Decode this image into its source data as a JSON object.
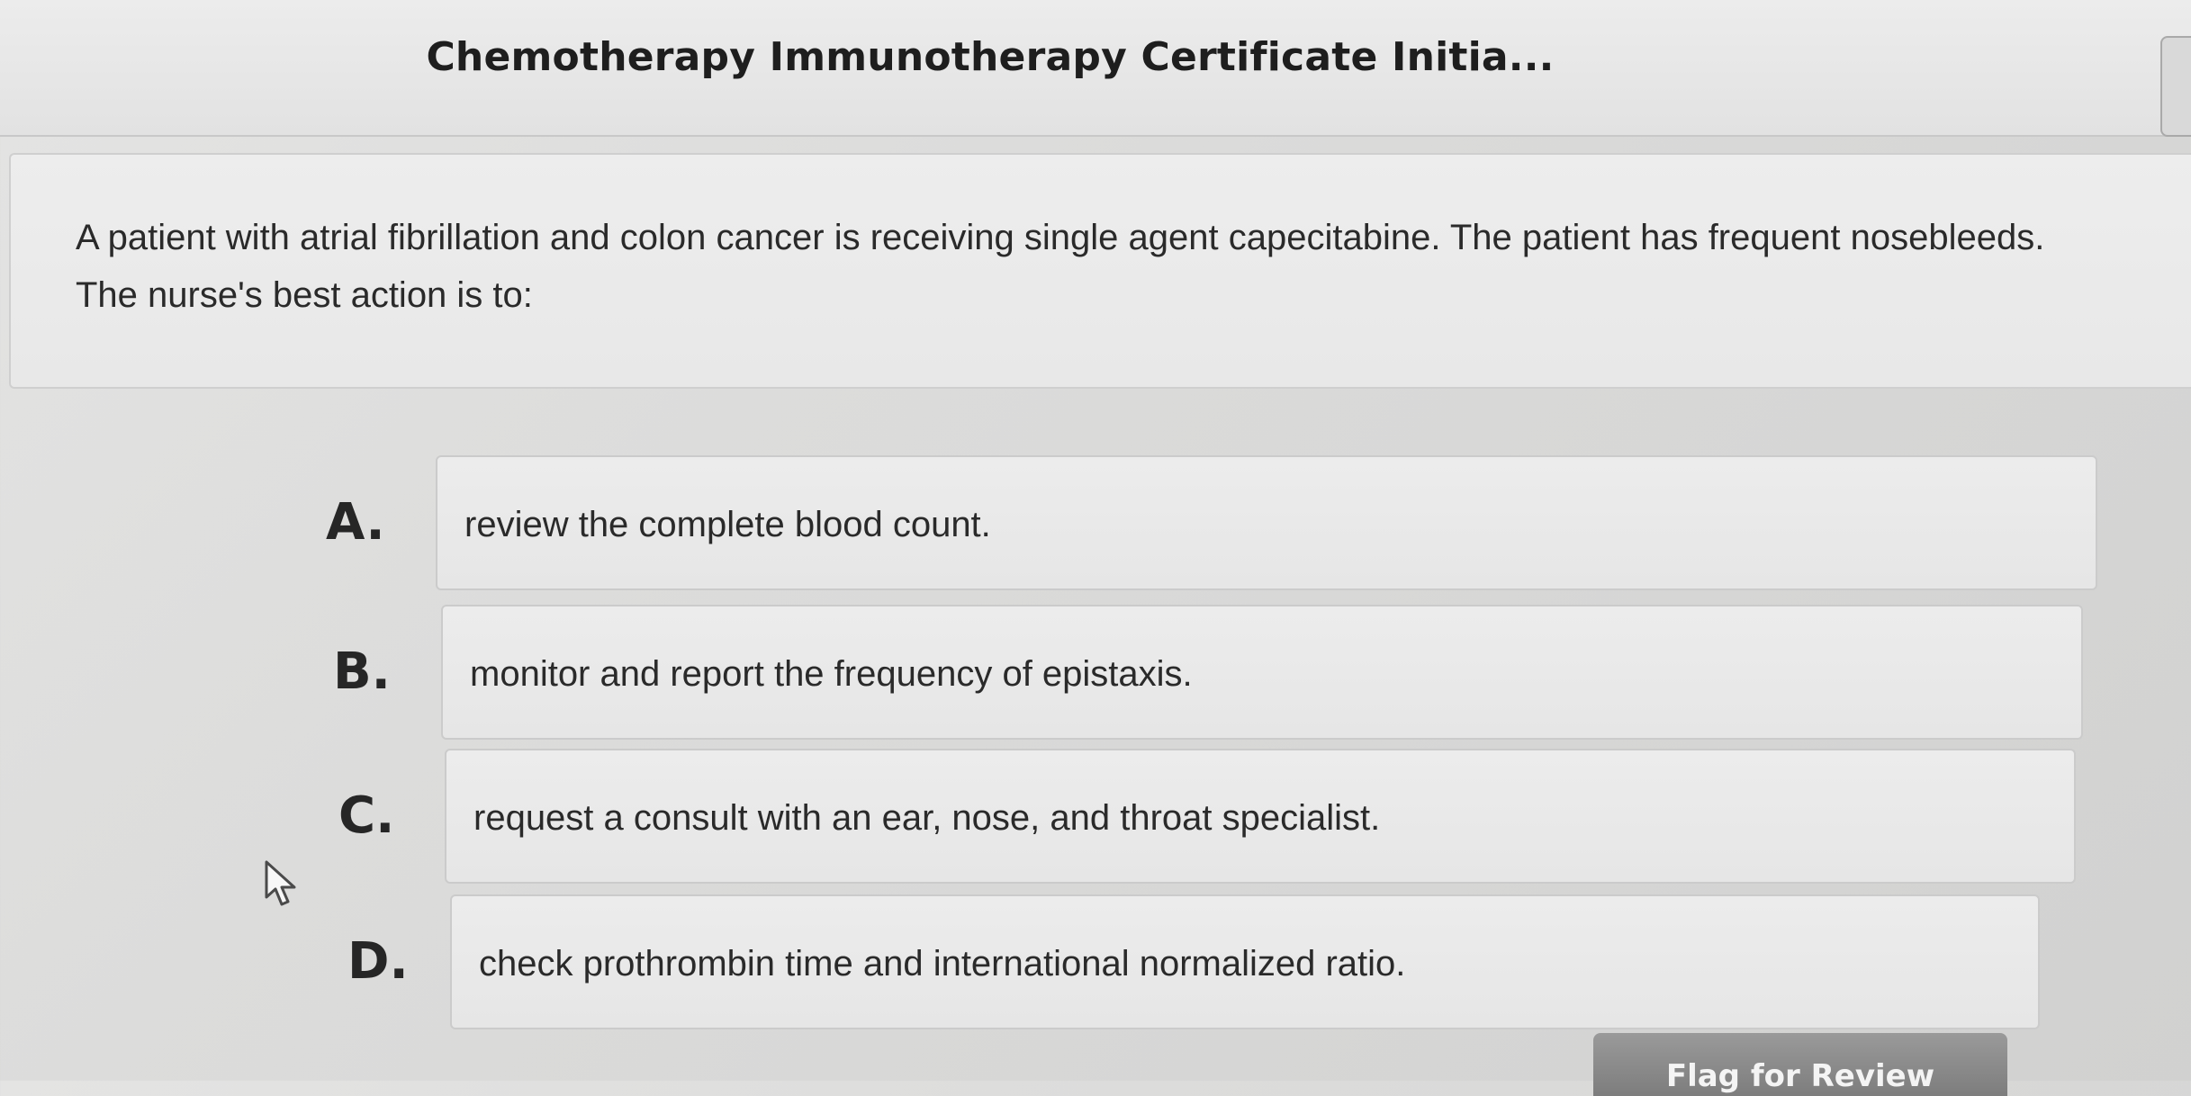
{
  "header": {
    "title": "Chemotherapy Immunotherapy Certificate Initia..."
  },
  "question": {
    "text": "A patient with atrial fibrillation and colon cancer is receiving single agent capecitabine. The patient has frequent nosebleeds. The nurse's best action is to:"
  },
  "answers": [
    {
      "letter": "A.",
      "text": "review the complete blood count."
    },
    {
      "letter": "B.",
      "text": "monitor and report the frequency of epistaxis."
    },
    {
      "letter": "C.",
      "text": "request a consult with an ear, nose, and throat specialist."
    },
    {
      "letter": "D.",
      "text": "check prothrombin time and international normalized ratio."
    }
  ],
  "footer": {
    "flag_label": "Flag for Review"
  },
  "icons": {
    "cursor": "mouse-pointer-icon"
  }
}
